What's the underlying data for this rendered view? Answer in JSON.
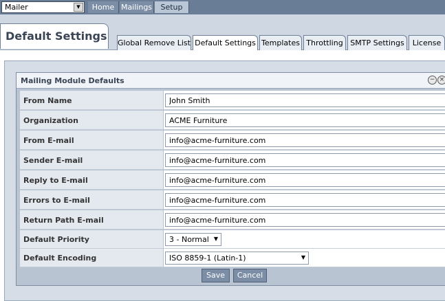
{
  "topbar": {
    "module_select": "Mailer",
    "nav": [
      "Home",
      "Mailings",
      "Setup"
    ],
    "active_nav": "Setup"
  },
  "page": {
    "title": "Default Settings",
    "tabs": [
      "Global Remove List",
      "Default Settings",
      "Templates",
      "Throttling",
      "SMTP Settings",
      "License"
    ],
    "active_tab": "Default Settings"
  },
  "panel": {
    "title": "Mailing Module Defaults",
    "fields": [
      {
        "label": "From Name",
        "value": "John Smith"
      },
      {
        "label": "Organization",
        "value": "ACME Furniture"
      },
      {
        "label": "From E-mail",
        "value": "info@acme-furniture.com"
      },
      {
        "label": "Sender E-mail",
        "value": "info@acme-furniture.com"
      },
      {
        "label": "Reply to E-mail",
        "value": "info@acme-furniture.com"
      },
      {
        "label": "Errors to E-mail",
        "value": "info@acme-furniture.com"
      },
      {
        "label": "Return Path E-mail",
        "value": "info@acme-furniture.com"
      }
    ],
    "priority": {
      "label": "Default Priority",
      "value": "3 - Normal"
    },
    "encoding": {
      "label": "Default Encoding",
      "value": "ISO 8859-1 (Latin-1)"
    },
    "save_label": "Save",
    "cancel_label": "Cancel"
  }
}
